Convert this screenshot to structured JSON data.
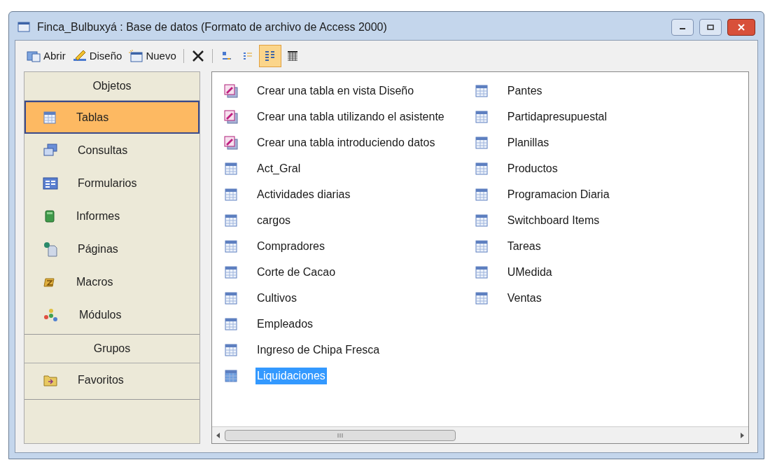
{
  "window": {
    "title": "Finca_Bulbuxyá : Base de datos (Formato de archivo de Access 2000)"
  },
  "toolbar": [
    {
      "kind": "open",
      "label": "Abrir"
    },
    {
      "kind": "design",
      "label": "Diseño"
    },
    {
      "kind": "new",
      "label": "Nuevo"
    },
    {
      "kind": "separator"
    },
    {
      "kind": "delete",
      "selected": false
    },
    {
      "kind": "separator"
    },
    {
      "kind": "large-icons",
      "selected": false
    },
    {
      "kind": "small-icons",
      "selected": false
    },
    {
      "kind": "list",
      "selected": true
    },
    {
      "kind": "details",
      "selected": false
    }
  ],
  "sidebar": {
    "sections": [
      {
        "title": "Objetos",
        "items": [
          {
            "kind": "tables",
            "label": "Tablas",
            "selected": true
          },
          {
            "kind": "queries",
            "label": "Consultas",
            "selected": false
          },
          {
            "kind": "forms",
            "label": "Formularios",
            "selected": false
          },
          {
            "kind": "reports",
            "label": "Informes",
            "selected": false
          },
          {
            "kind": "pages",
            "label": "Páginas",
            "selected": false
          },
          {
            "kind": "macros",
            "label": "Macros",
            "selected": false
          },
          {
            "kind": "modules",
            "label": "Módulos",
            "selected": false
          }
        ]
      },
      {
        "title": "Grupos",
        "items": [
          {
            "kind": "favorites",
            "label": "Favoritos",
            "selected": false
          }
        ]
      }
    ]
  },
  "list": {
    "items": [
      {
        "kind": "wizard",
        "label": "Crear una tabla en vista Diseño",
        "selected": false
      },
      {
        "kind": "wizard",
        "label": "Crear una tabla utilizando el asistente",
        "selected": false
      },
      {
        "kind": "wizard",
        "label": "Crear una tabla introduciendo datos",
        "selected": false
      },
      {
        "kind": "table",
        "label": "Act_Gral",
        "selected": false
      },
      {
        "kind": "table",
        "label": "Actividades diarias",
        "selected": false
      },
      {
        "kind": "table",
        "label": "cargos",
        "selected": false
      },
      {
        "kind": "table",
        "label": "Compradores",
        "selected": false
      },
      {
        "kind": "table",
        "label": "Corte de Cacao",
        "selected": false
      },
      {
        "kind": "table",
        "label": "Cultivos",
        "selected": false
      },
      {
        "kind": "table",
        "label": "Empleados",
        "selected": false
      },
      {
        "kind": "table",
        "label": "Ingreso de Chipa Fresca",
        "selected": false
      },
      {
        "kind": "table",
        "label": "Liquidaciones",
        "selected": true
      },
      {
        "kind": "table",
        "label": "Pantes",
        "selected": false
      },
      {
        "kind": "table",
        "label": "Partidapresupuestal",
        "selected": false
      },
      {
        "kind": "table",
        "label": "Planillas",
        "selected": false
      },
      {
        "kind": "table",
        "label": "Productos",
        "selected": false
      },
      {
        "kind": "table",
        "label": "Programacion Diaria",
        "selected": false
      },
      {
        "kind": "table",
        "label": "Switchboard Items",
        "selected": false
      },
      {
        "kind": "table",
        "label": "Tareas",
        "selected": false
      },
      {
        "kind": "table",
        "label": "UMedida",
        "selected": false
      },
      {
        "kind": "table",
        "label": "Ventas",
        "selected": false
      }
    ]
  }
}
